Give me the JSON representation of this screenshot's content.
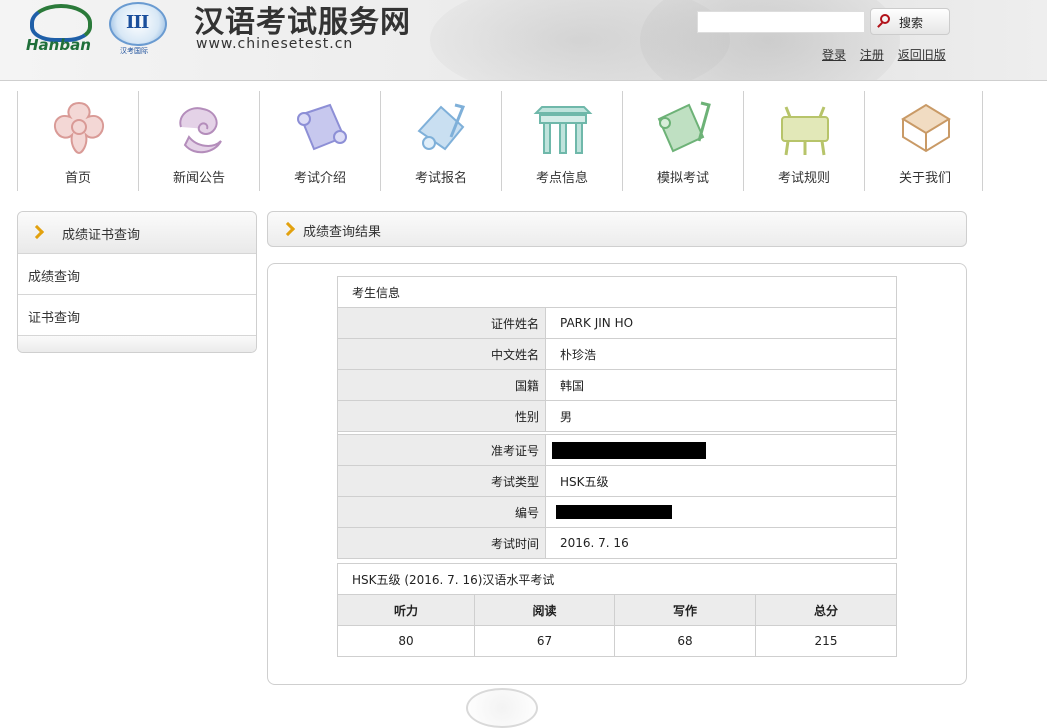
{
  "header": {
    "logo_hanban": "Hanban",
    "logo_intl": "汉考国际",
    "site_title": "汉语考试服务网",
    "site_url": "www.chinesetest.cn",
    "search_placeholder": "",
    "search_button": "搜索",
    "links": [
      "登录",
      "注册",
      "返回旧版"
    ]
  },
  "nav": {
    "items": [
      {
        "label": "首页",
        "icon": "home-knot-icon"
      },
      {
        "label": "新闻公告",
        "icon": "news-cloud-icon"
      },
      {
        "label": "考试介绍",
        "icon": "exam-intro-scroll-icon"
      },
      {
        "label": "考试报名",
        "icon": "registration-scroll-icon"
      },
      {
        "label": "考点信息",
        "icon": "test-center-gate-icon"
      },
      {
        "label": "模拟考试",
        "icon": "mock-exam-scroll-icon"
      },
      {
        "label": "考试规则",
        "icon": "rules-ding-icon"
      },
      {
        "label": "关于我们",
        "icon": "about-us-table-icon"
      }
    ]
  },
  "sidebar": {
    "title": "成绩证书查询",
    "items": [
      "成绩查询",
      "证书查询"
    ]
  },
  "result": {
    "title": "成绩查询结果",
    "info_caption": "考生信息",
    "rows": [
      {
        "key": "证件姓名",
        "value": "PARK JIN HO"
      },
      {
        "key": "中文姓名",
        "value": "朴珍浩"
      },
      {
        "key": "国籍",
        "value": "韩国"
      },
      {
        "key": "性别",
        "value": "男"
      }
    ],
    "rows2": [
      {
        "key": "准考证号",
        "value": "",
        "redacted": true
      },
      {
        "key": "考试类型",
        "value": "HSK五级"
      },
      {
        "key": "编号",
        "value": "",
        "redacted": true
      },
      {
        "key": "考试时间",
        "value": "2016. 7. 16"
      }
    ],
    "score_caption": "HSK五级 (2016. 7. 16)汉语水平考试",
    "score_headers": [
      "听力",
      "阅读",
      "写作",
      "总分"
    ],
    "score_values": [
      "80",
      "67",
      "68",
      "215"
    ]
  },
  "colors": {
    "accent_arrow": "#e2a10e",
    "header_bg": "#ececec",
    "table_key_bg": "#ececec"
  }
}
